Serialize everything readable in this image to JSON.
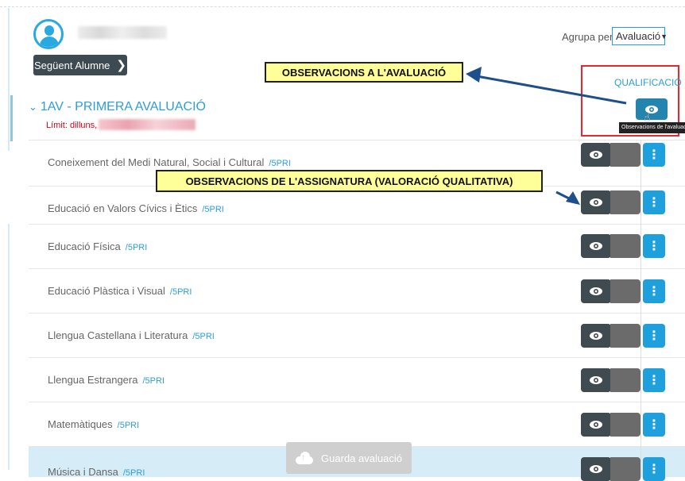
{
  "header": {
    "next_student_label": "Següent Alumne",
    "group_by_label": "Agrupa per:",
    "group_by_value": "Avaluació"
  },
  "evaluation": {
    "title": "1AV - PRIMERA AVALUACIÓ",
    "limit_label": "Límit: dilluns,"
  },
  "qualification": {
    "header": "QUALIFICACIÓ",
    "tooltip": "Observacions de l'avaluació"
  },
  "callouts": {
    "evaluation_observations": "OBSERVACIONS A L'AVALUACIÓ",
    "subject_observations": "OBSERVACIONS DE L'ASSIGNATURA (VALORACIÓ QUALITATIVA)"
  },
  "subjects": [
    {
      "name": "Coneixement del Medi Natural, Social i Cultural",
      "group": "/5PRI"
    },
    {
      "name": "Educació en Valors Cívics i Ètics",
      "group": "/5PRI"
    },
    {
      "name": "Educació Física",
      "group": "/5PRI"
    },
    {
      "name": "Educació Plàstica i Visual",
      "group": "/5PRI"
    },
    {
      "name": "Llengua Castellana i Literatura",
      "group": "/5PRI"
    },
    {
      "name": "Llengua Estrangera",
      "group": "/5PRI"
    },
    {
      "name": "Matemàtiques",
      "group": "/5PRI"
    },
    {
      "name": "Música i Dansa",
      "group": "/5PRI"
    }
  ],
  "save_button": "Guarda avaluació",
  "icons": {
    "avatar": "user-icon",
    "next": "chevron-right-icon",
    "select": "chevron-down-icon",
    "view": "eye-icon",
    "menu": "vertical-ellipsis-icon",
    "save": "cloud-upload-icon"
  },
  "colors": {
    "accent": "#2e9fd4",
    "callout": "#ffff99",
    "highlight_box": "#e8262d",
    "limit_text": "#d0021b",
    "dark_button": "#3f4a51",
    "menu_button": "#1ea0dc"
  }
}
